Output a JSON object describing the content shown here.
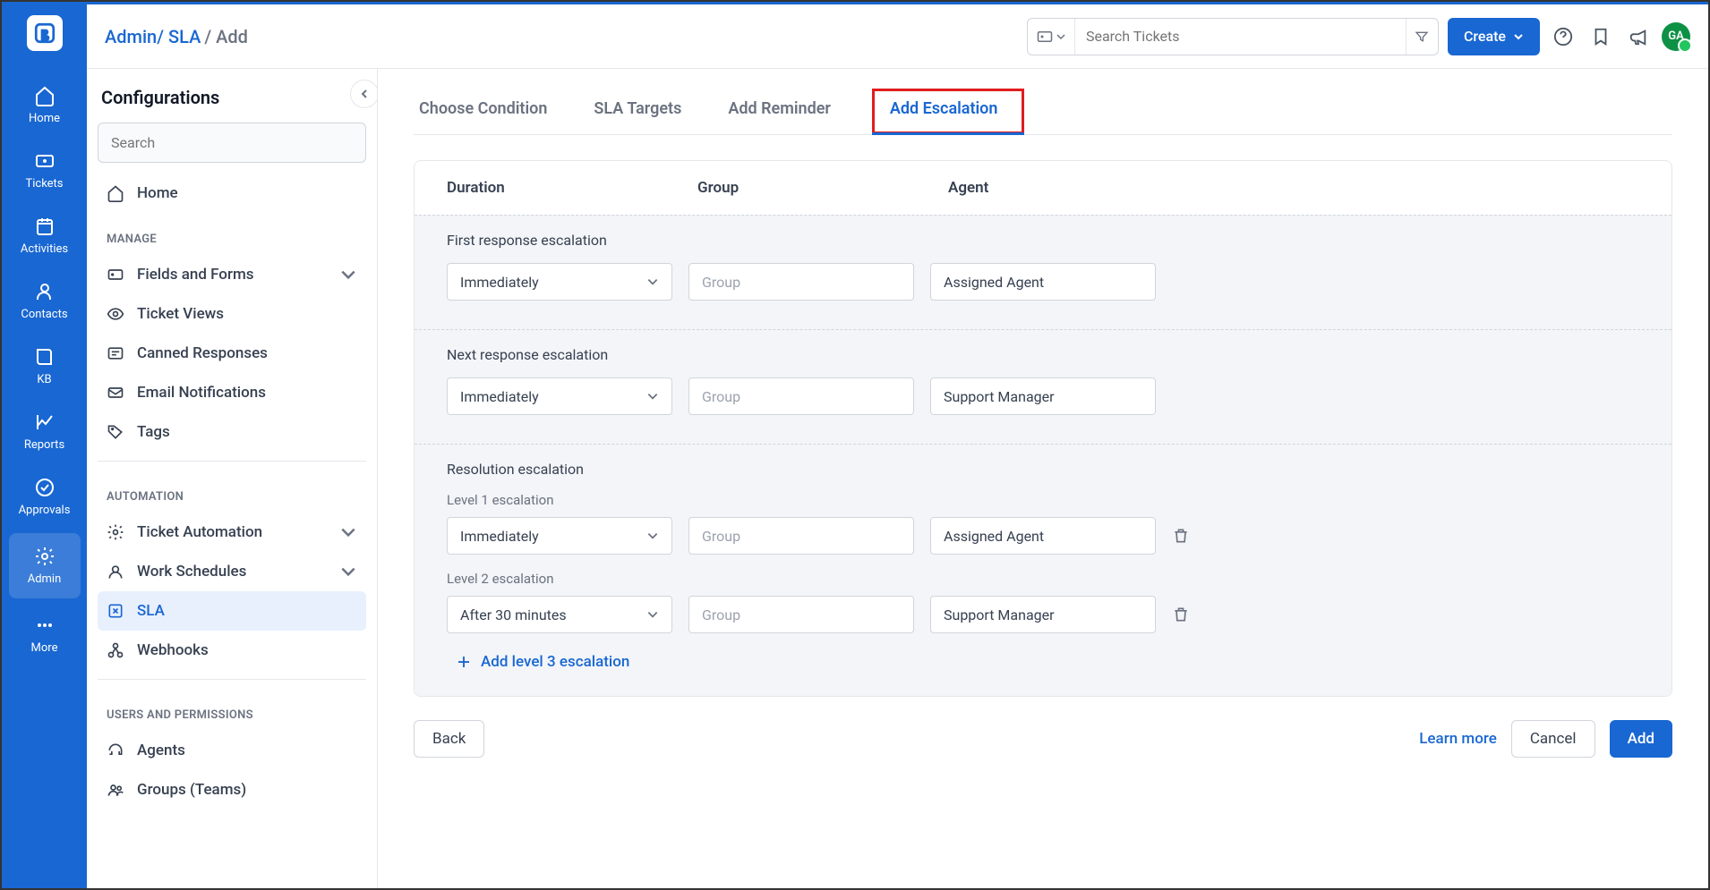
{
  "nav": {
    "items": [
      {
        "label": "Home"
      },
      {
        "label": "Tickets"
      },
      {
        "label": "Activities"
      },
      {
        "label": "Contacts"
      },
      {
        "label": "KB"
      },
      {
        "label": "Reports"
      },
      {
        "label": "Approvals"
      },
      {
        "label": "Admin"
      },
      {
        "label": "More"
      }
    ]
  },
  "breadcrumb": {
    "part1": "Admin",
    "part2": "SLA",
    "part3": "Add"
  },
  "search": {
    "placeholder": "Search Tickets"
  },
  "create_label": "Create",
  "avatar_initials": "GA",
  "sidebar": {
    "title": "Configurations",
    "search_placeholder": "Search",
    "home": "Home",
    "sections": {
      "manage": "MANAGE",
      "automation": "AUTOMATION",
      "users": "USERS AND PERMISSIONS"
    },
    "items": {
      "fields": "Fields and Forms",
      "views": "Ticket Views",
      "canned": "Canned Responses",
      "email": "Email Notifications",
      "tags": "Tags",
      "automation_item": "Ticket Automation",
      "work": "Work Schedules",
      "sla": "SLA",
      "webhooks": "Webhooks",
      "agents": "Agents",
      "groups": "Groups (Teams)"
    }
  },
  "tabs": [
    {
      "label": "Choose Condition"
    },
    {
      "label": "SLA Targets"
    },
    {
      "label": "Add Reminder"
    },
    {
      "label": "Add Escalation"
    }
  ],
  "columns": {
    "duration": "Duration",
    "group": "Group",
    "agent": "Agent"
  },
  "escalations": {
    "first": {
      "title": "First response escalation",
      "duration": "Immediately",
      "group_placeholder": "Group",
      "agent": "Assigned Agent"
    },
    "next": {
      "title": "Next response escalation",
      "duration": "Immediately",
      "group_placeholder": "Group",
      "agent": "Support Manager"
    },
    "resolution": {
      "title": "Resolution escalation",
      "level1_label": "Level 1 escalation",
      "level1": {
        "duration": "Immediately",
        "group_placeholder": "Group",
        "agent": "Assigned Agent"
      },
      "level2_label": "Level 2 escalation",
      "level2": {
        "duration": "After 30 minutes",
        "group_placeholder": "Group",
        "agent": "Support Manager"
      },
      "add_label": "Add level 3 escalation"
    }
  },
  "footer": {
    "back": "Back",
    "learn": "Learn more",
    "cancel": "Cancel",
    "add": "Add"
  }
}
